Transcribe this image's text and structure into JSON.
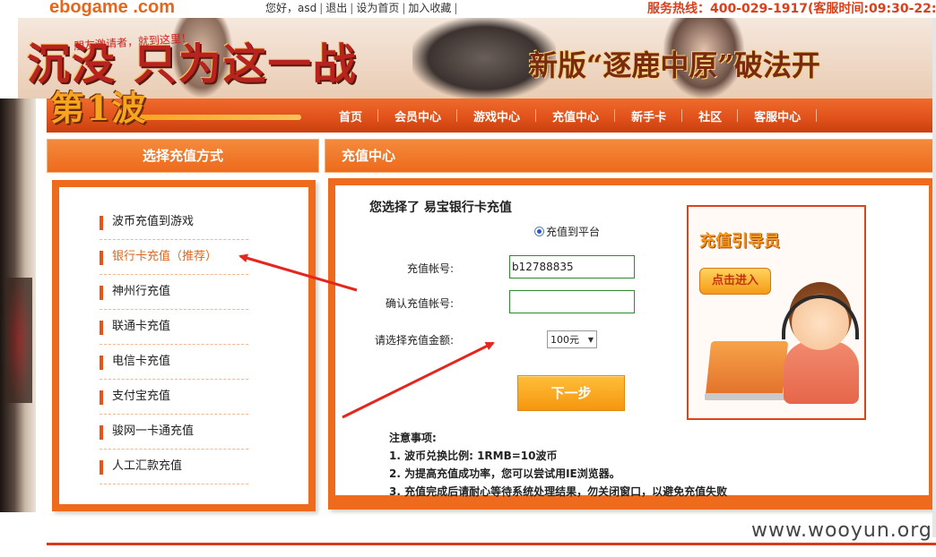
{
  "topbar": {
    "logo_prefix": "ebogame",
    "logo_suffix": " .com",
    "greeting": "您好，asd",
    "links": [
      "退出",
      "设为首页",
      "加入收藏"
    ],
    "hotline": "服务热线：400-029-1917(客服时间:09:30-22:"
  },
  "banner": {
    "title": "沉没 只为这一战",
    "subtitle": "新版“逐鹿中原”破法开",
    "small_red": "朋友激请者，就到这里！",
    "badge": "第1波"
  },
  "nav": {
    "items": [
      "首页",
      "会员中心",
      "游戏中心",
      "充值中心",
      "新手卡",
      "社区",
      "客服中心"
    ]
  },
  "left": {
    "heading": "选择充值方式",
    "methods": [
      "波币充值到游戏",
      "银行卡充值（推荐）",
      "神州行充值",
      "联通卡充值",
      "电信卡充值",
      "支付宝充值",
      "骏网一卡通充值",
      "人工汇款充值"
    ],
    "active_index": 1
  },
  "right": {
    "heading": "充值中心",
    "selected_title": "您选择了 易宝银行卡充值",
    "radio_label": "充值到平台",
    "account_label": "充值帐号:",
    "account_value": "b12788835",
    "confirm_label": "确认充值帐号:",
    "confirm_value": "",
    "amount_label": "请选择充值金额:",
    "amount_value": "100元",
    "next_label": "下一步",
    "notes_title": "注意事项:",
    "notes": [
      "1. 波币兑换比例: 1RMB=10波币",
      "2. 为提高充值成功率，您可以尝试用IE浏览器。",
      "3. 充值完成后请耐心等待系统处理结果，勿关闭窗口，以避免充值失败"
    ]
  },
  "guide": {
    "title": "充值引导员",
    "button": "点击进入"
  },
  "watermark": "www.wooyun.org",
  "colors": {
    "accent": "#ee6a1c",
    "nav": "#e0501a",
    "arrow": "#e5261e",
    "active": "#e2661b"
  }
}
